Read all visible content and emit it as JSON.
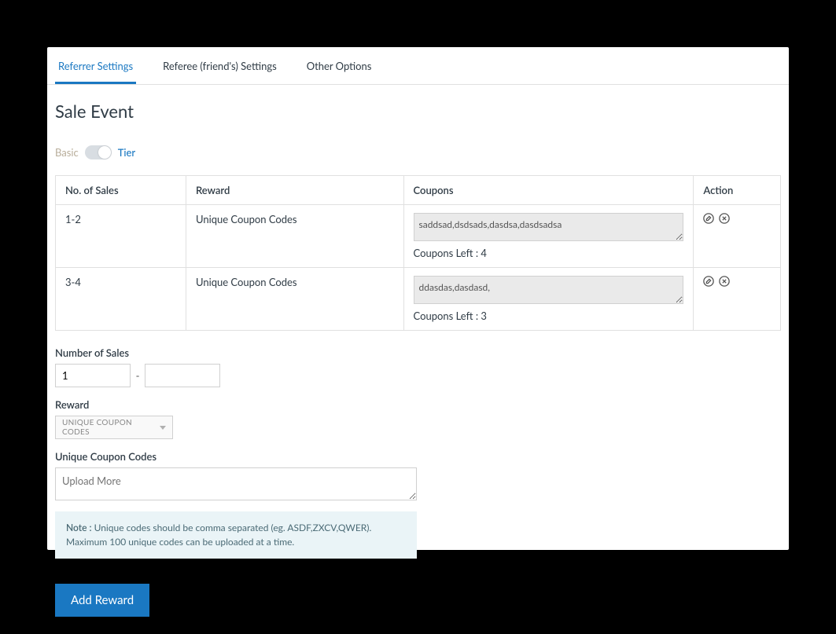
{
  "tabs": {
    "referrer": "Referrer Settings",
    "referee": "Referee (friend's) Settings",
    "other": "Other Options"
  },
  "page_title": "Sale Event",
  "toggle": {
    "left": "Basic",
    "right": "Tier"
  },
  "table": {
    "headers": {
      "sales": "No. of Sales",
      "reward": "Reward",
      "coupons": "Coupons",
      "action": "Action"
    },
    "rows": [
      {
        "sales": "1-2",
        "reward": "Unique Coupon Codes",
        "coupons_value": "saddsad,dsdsads,dasdsa,dasdsadsa",
        "coupons_left": "Coupons Left : 4"
      },
      {
        "sales": "3-4",
        "reward": "Unique Coupon Codes",
        "coupons_value": "ddasdas,dasdasd,",
        "coupons_left": "Coupons Left : 3"
      }
    ]
  },
  "form": {
    "number_of_sales_label": "Number of Sales",
    "range_from": "1",
    "range_sep": "-",
    "range_to": "",
    "reward_label": "Reward",
    "reward_selected": "UNIQUE COUPON CODES",
    "codes_label": "Unique Coupon Codes",
    "upload_placeholder": "Upload More",
    "note_label": "Note :",
    "note_text": " Unique codes should be comma separated (eg. ASDF,ZXCV,QWER). Maximum 100 unique codes can be uploaded at a time.",
    "add_button": "Add Reward"
  }
}
